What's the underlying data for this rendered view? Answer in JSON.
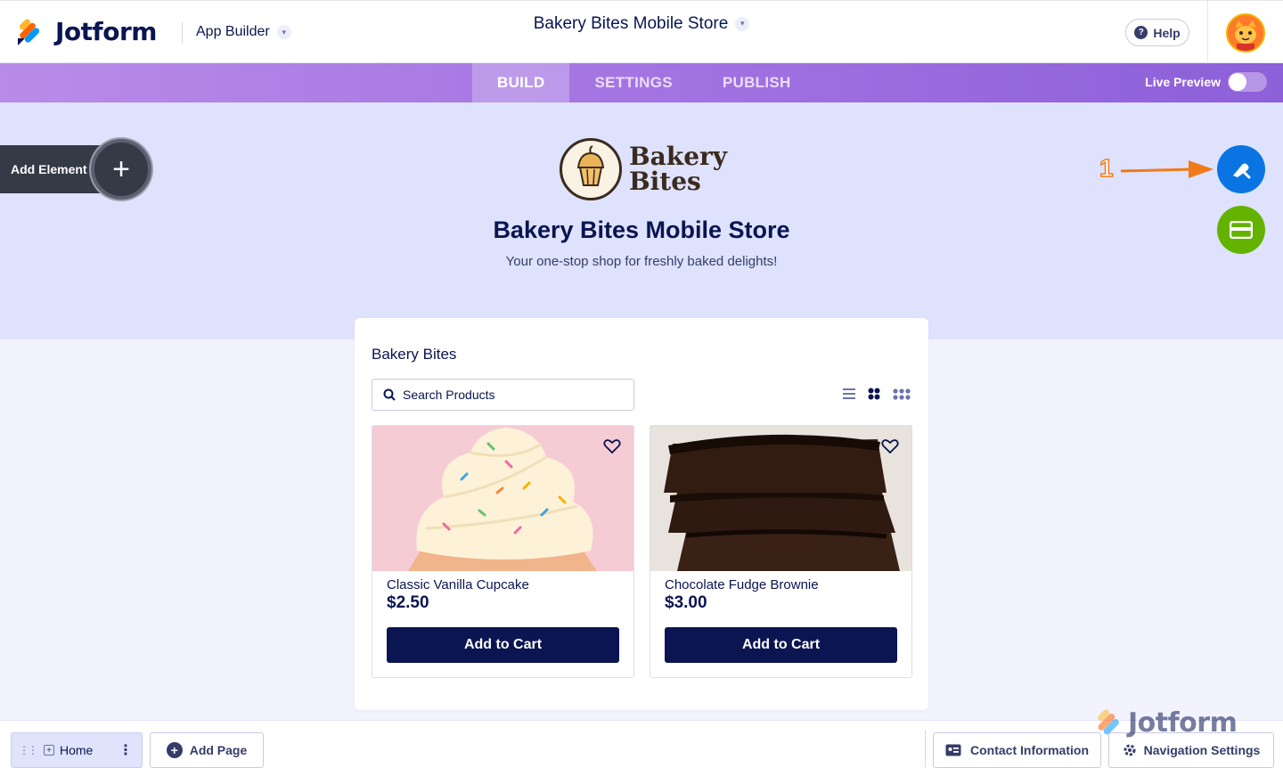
{
  "header": {
    "logo_text": "Jotform",
    "app_builder_label": "App Builder",
    "app_title": "Bakery Bites Mobile Store",
    "help_label": "Help"
  },
  "nav": {
    "tabs": [
      {
        "label": "BUILD",
        "active": true
      },
      {
        "label": "SETTINGS",
        "active": false
      },
      {
        "label": "PUBLISH",
        "active": false
      }
    ],
    "live_preview_label": "Live Preview",
    "live_preview_on": false
  },
  "hero": {
    "brand_line1": "Bakery",
    "brand_line2": "Bites",
    "title": "Bakery Bites Mobile Store",
    "subtitle": "Your one-stop shop for freshly baked delights!"
  },
  "add_element_label": "Add Element",
  "annotation_number": "1",
  "store": {
    "title": "Bakery Bites",
    "search_placeholder": "Search Products",
    "products": [
      {
        "name": "Classic Vanilla Cupcake",
        "price": "$2.50",
        "button": "Add to Cart"
      },
      {
        "name": "Chocolate Fudge Brownie",
        "price": "$3.00",
        "button": "Add to Cart"
      }
    ]
  },
  "bottom": {
    "page_label": "Home",
    "add_page_label": "Add Page",
    "contact_label": "Contact Information",
    "navigation_label": "Navigation Settings"
  },
  "watermark_text": "Jotform",
  "colors": {
    "brand_navy": "#0a1551",
    "nav_purple": "#a374e2",
    "hero_bg": "#dee2fc",
    "fab_blue": "#0a75e2",
    "fab_green": "#64b200",
    "annotation_orange": "#f07a1a"
  }
}
